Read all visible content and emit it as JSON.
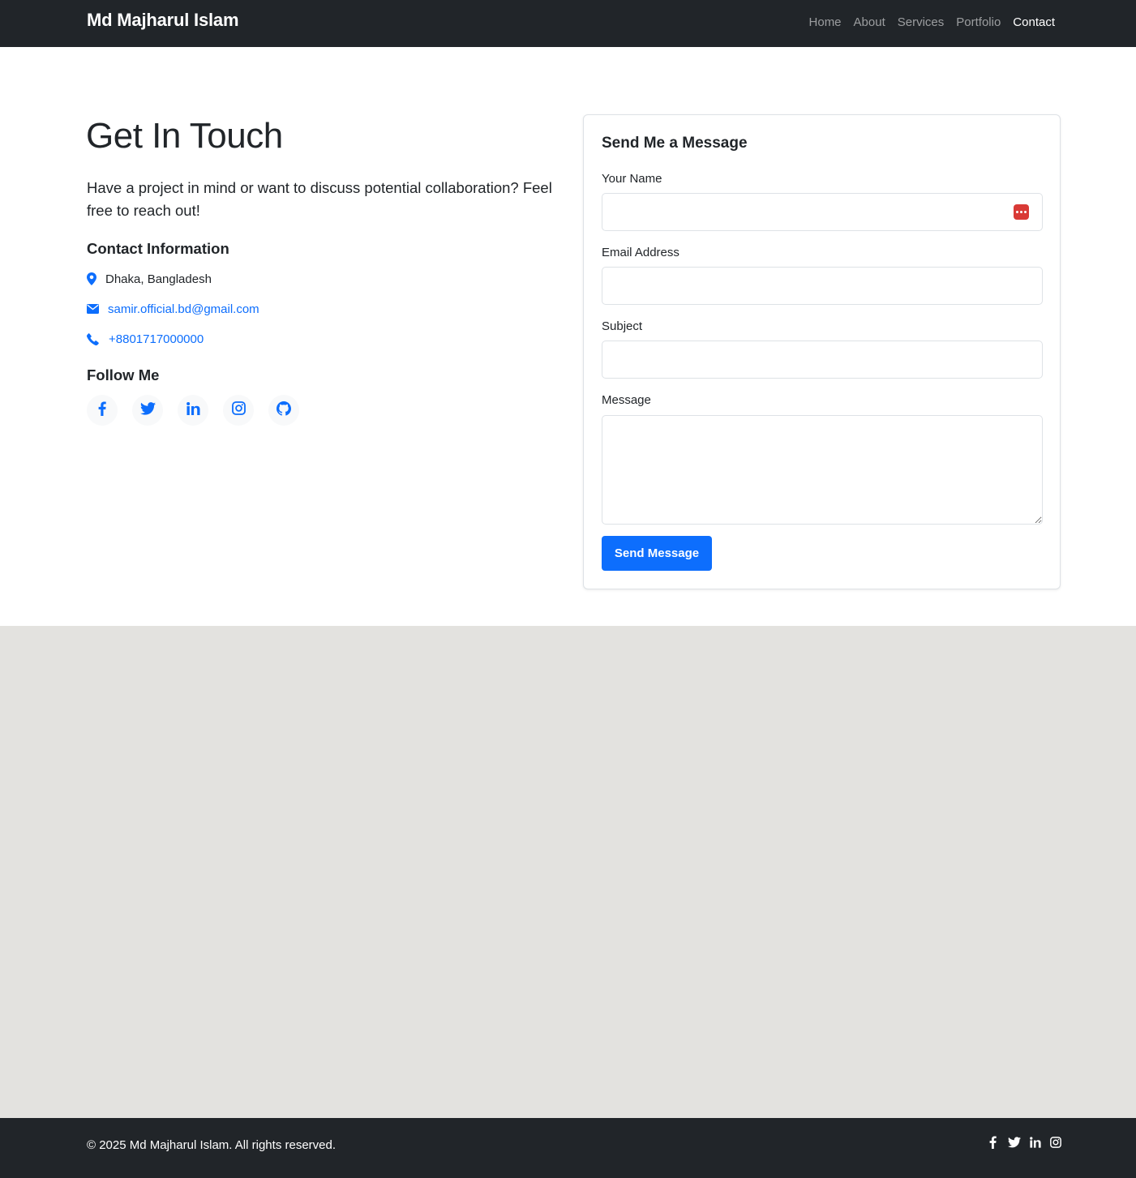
{
  "navbar": {
    "brand": "Md Majharul Islam",
    "links": [
      "Home",
      "About",
      "Services",
      "Portfolio",
      "Contact"
    ],
    "active": "Contact"
  },
  "hero": {
    "title": "Get In Touch",
    "lead": "Have a project in mind or want to discuss potential collaboration? Feel free to reach out!"
  },
  "contact_info": {
    "heading": "Contact Information",
    "location": "Dhaka, Bangladesh",
    "email": "samir.official.bd@gmail.com",
    "phone": "+8801717000000"
  },
  "follow": {
    "heading": "Follow Me",
    "icons": [
      "facebook-icon",
      "twitter-icon",
      "linkedin-icon",
      "instagram-icon",
      "github-icon"
    ]
  },
  "form": {
    "title": "Send Me a Message",
    "name_label": "Your Name",
    "name_value": "",
    "email_label": "Email Address",
    "email_value": "",
    "subject_label": "Subject",
    "subject_value": "",
    "message_label": "Message",
    "message_value": "",
    "submit_label": "Send Message"
  },
  "footer": {
    "copyright": "© 2025 Md Majharul Islam. All rights reserved.",
    "icons": [
      "facebook-icon",
      "twitter-icon",
      "linkedin-icon",
      "instagram-icon"
    ]
  },
  "colors": {
    "navbar_bg": "#212529",
    "accent": "#0d6efd",
    "page_gray": "#e3e2df",
    "password_badge": "#d93a36"
  }
}
